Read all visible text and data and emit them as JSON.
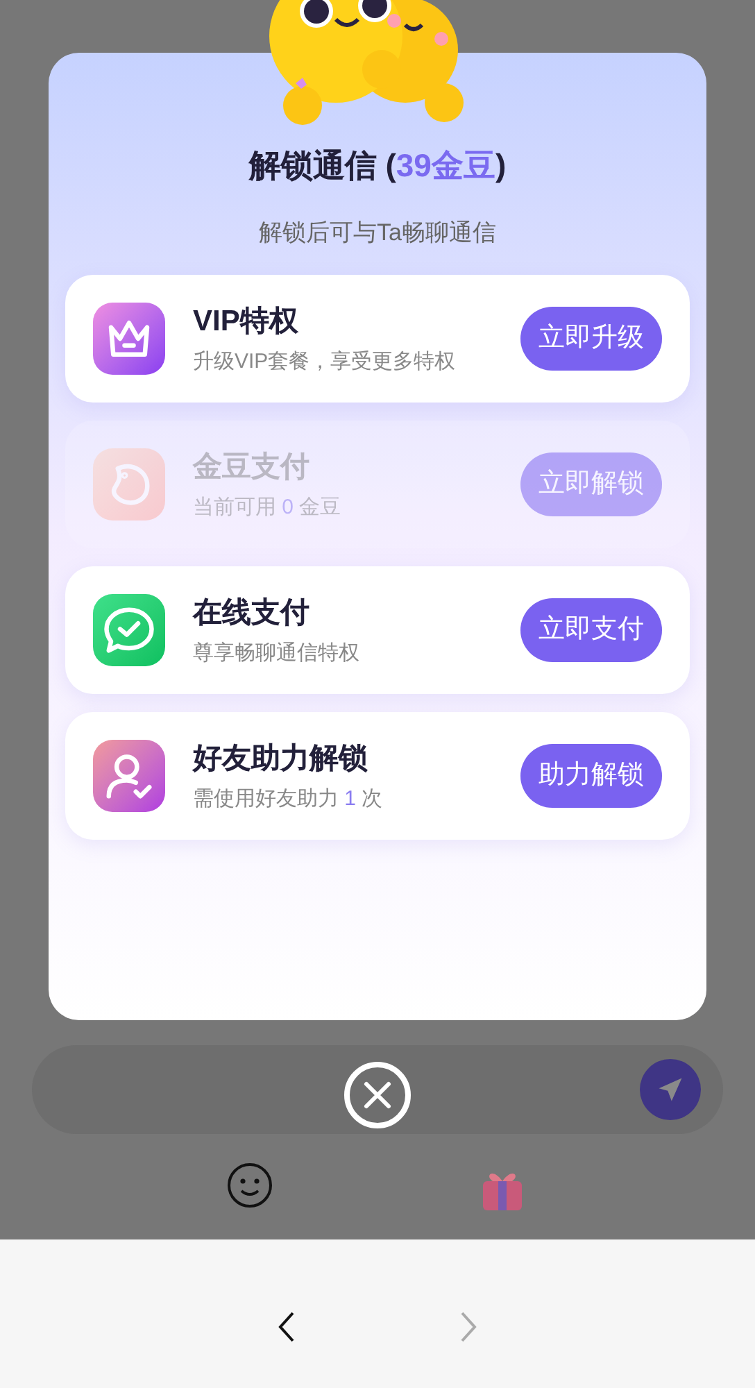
{
  "dialog": {
    "title_parts": [
      {
        "text": "解锁通信 (",
        "highlight": false
      },
      {
        "text": "39金豆",
        "highlight": true
      },
      {
        "text": ")",
        "highlight": false
      }
    ],
    "subtitle": "解锁后可与Ta畅聊通信",
    "options": [
      {
        "kind": "vip",
        "title": "VIP特权",
        "subtitle_parts": [
          {
            "text": "升级VIP套餐，享受更多特权",
            "highlight": false
          }
        ],
        "button": "立即升级",
        "disabled": false
      },
      {
        "kind": "beans",
        "title": "金豆支付",
        "subtitle_parts": [
          {
            "text": "当前可用 ",
            "highlight": false
          },
          {
            "text": "0",
            "highlight": true
          },
          {
            "text": " 金豆",
            "highlight": false
          }
        ],
        "button": "立即解锁",
        "disabled": true
      },
      {
        "kind": "online",
        "title": "在线支付",
        "subtitle_parts": [
          {
            "text": "尊享畅聊通信特权",
            "highlight": false
          }
        ],
        "button": "立即支付",
        "disabled": false
      },
      {
        "kind": "friend",
        "title": "好友助力解锁",
        "subtitle_parts": [
          {
            "text": "需使用好友助力 ",
            "highlight": false
          },
          {
            "text": "1",
            "highlight": true
          },
          {
            "text": " 次",
            "highlight": false
          }
        ],
        "button": "助力解锁",
        "disabled": false
      }
    ]
  },
  "nav": [
    {
      "kind": "back",
      "disabled": false
    },
    {
      "kind": "forward",
      "disabled": true
    }
  ]
}
